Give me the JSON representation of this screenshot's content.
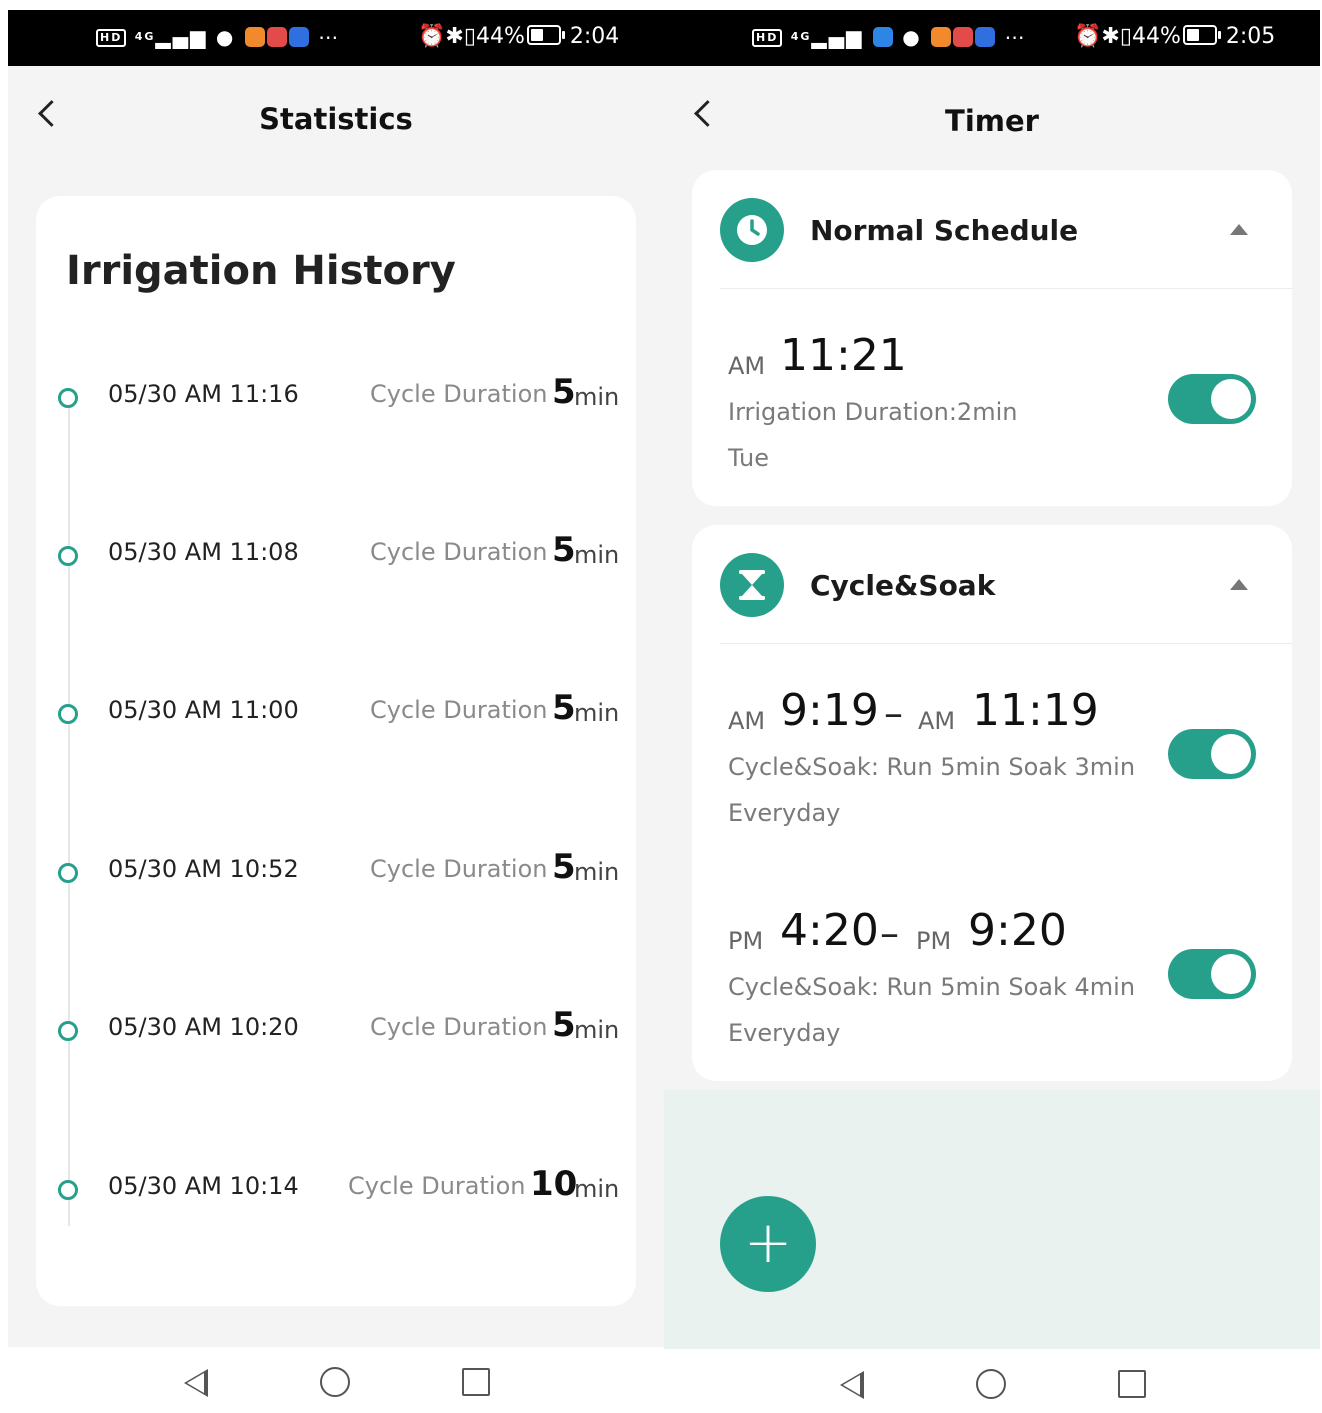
{
  "left": {
    "status": {
      "signal": "4G",
      "battery": "44%",
      "time": "2:04"
    },
    "header": {
      "title": "Statistics"
    },
    "history": {
      "title": "Irrigation History",
      "label": "Cycle Duration",
      "unit": "min",
      "items": [
        {
          "date": "05/30 AM 11:16",
          "value": "5"
        },
        {
          "date": "05/30 AM 11:08",
          "value": "5"
        },
        {
          "date": "05/30 AM 11:00",
          "value": "5"
        },
        {
          "date": "05/30 AM 10:52",
          "value": "5"
        },
        {
          "date": "05/30 AM 10:20",
          "value": "5"
        },
        {
          "date": "05/30 AM 10:14",
          "value": "10"
        }
      ]
    }
  },
  "right": {
    "status": {
      "signal": "4G",
      "battery": "44%",
      "time": "2:05"
    },
    "header": {
      "title": "Timer"
    },
    "normal": {
      "title": "Normal Schedule",
      "item": {
        "ampm": "AM",
        "time": "11:21",
        "line1": "Irrigation Duration:2min",
        "line2": "Tue",
        "enabled": true
      }
    },
    "cycle": {
      "title": "Cycle&Soak",
      "items": [
        {
          "start_ampm": "AM",
          "start": "9:19",
          "end_ampm": "AM",
          "end": "11:19",
          "line1": "Cycle&Soak: Run 5min Soak 3min",
          "line2": "Everyday",
          "enabled": true
        },
        {
          "start_ampm": "PM",
          "start": "4:20",
          "end_ampm": "PM",
          "end": "9:20",
          "line1": "Cycle&Soak: Run 5min Soak 4min",
          "line2": "Everyday",
          "enabled": true
        }
      ]
    },
    "add_label": "+"
  },
  "colors": {
    "accent": "#26a08b",
    "background": "#f4f4f4",
    "card": "#ffffff"
  }
}
